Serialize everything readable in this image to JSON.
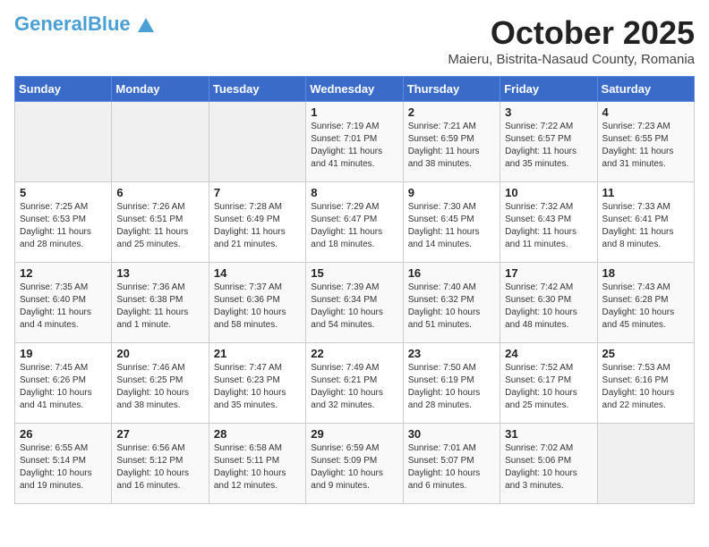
{
  "header": {
    "logo_general": "General",
    "logo_blue": "Blue",
    "title": "October 2025",
    "subtitle": "Maieru, Bistrita-Nasaud County, Romania"
  },
  "weekdays": [
    "Sunday",
    "Monday",
    "Tuesday",
    "Wednesday",
    "Thursday",
    "Friday",
    "Saturday"
  ],
  "weeks": [
    [
      {
        "day": "",
        "empty": true
      },
      {
        "day": "",
        "empty": true
      },
      {
        "day": "",
        "empty": true
      },
      {
        "day": "1",
        "sunrise": "7:19 AM",
        "sunset": "7:01 PM",
        "daylight": "11 hours and 41 minutes."
      },
      {
        "day": "2",
        "sunrise": "7:21 AM",
        "sunset": "6:59 PM",
        "daylight": "11 hours and 38 minutes."
      },
      {
        "day": "3",
        "sunrise": "7:22 AM",
        "sunset": "6:57 PM",
        "daylight": "11 hours and 35 minutes."
      },
      {
        "day": "4",
        "sunrise": "7:23 AM",
        "sunset": "6:55 PM",
        "daylight": "11 hours and 31 minutes."
      }
    ],
    [
      {
        "day": "5",
        "sunrise": "7:25 AM",
        "sunset": "6:53 PM",
        "daylight": "11 hours and 28 minutes."
      },
      {
        "day": "6",
        "sunrise": "7:26 AM",
        "sunset": "6:51 PM",
        "daylight": "11 hours and 25 minutes."
      },
      {
        "day": "7",
        "sunrise": "7:28 AM",
        "sunset": "6:49 PM",
        "daylight": "11 hours and 21 minutes."
      },
      {
        "day": "8",
        "sunrise": "7:29 AM",
        "sunset": "6:47 PM",
        "daylight": "11 hours and 18 minutes."
      },
      {
        "day": "9",
        "sunrise": "7:30 AM",
        "sunset": "6:45 PM",
        "daylight": "11 hours and 14 minutes."
      },
      {
        "day": "10",
        "sunrise": "7:32 AM",
        "sunset": "6:43 PM",
        "daylight": "11 hours and 11 minutes."
      },
      {
        "day": "11",
        "sunrise": "7:33 AM",
        "sunset": "6:41 PM",
        "daylight": "11 hours and 8 minutes."
      }
    ],
    [
      {
        "day": "12",
        "sunrise": "7:35 AM",
        "sunset": "6:40 PM",
        "daylight": "11 hours and 4 minutes."
      },
      {
        "day": "13",
        "sunrise": "7:36 AM",
        "sunset": "6:38 PM",
        "daylight": "11 hours and 1 minute."
      },
      {
        "day": "14",
        "sunrise": "7:37 AM",
        "sunset": "6:36 PM",
        "daylight": "10 hours and 58 minutes."
      },
      {
        "day": "15",
        "sunrise": "7:39 AM",
        "sunset": "6:34 PM",
        "daylight": "10 hours and 54 minutes."
      },
      {
        "day": "16",
        "sunrise": "7:40 AM",
        "sunset": "6:32 PM",
        "daylight": "10 hours and 51 minutes."
      },
      {
        "day": "17",
        "sunrise": "7:42 AM",
        "sunset": "6:30 PM",
        "daylight": "10 hours and 48 minutes."
      },
      {
        "day": "18",
        "sunrise": "7:43 AM",
        "sunset": "6:28 PM",
        "daylight": "10 hours and 45 minutes."
      }
    ],
    [
      {
        "day": "19",
        "sunrise": "7:45 AM",
        "sunset": "6:26 PM",
        "daylight": "10 hours and 41 minutes."
      },
      {
        "day": "20",
        "sunrise": "7:46 AM",
        "sunset": "6:25 PM",
        "daylight": "10 hours and 38 minutes."
      },
      {
        "day": "21",
        "sunrise": "7:47 AM",
        "sunset": "6:23 PM",
        "daylight": "10 hours and 35 minutes."
      },
      {
        "day": "22",
        "sunrise": "7:49 AM",
        "sunset": "6:21 PM",
        "daylight": "10 hours and 32 minutes."
      },
      {
        "day": "23",
        "sunrise": "7:50 AM",
        "sunset": "6:19 PM",
        "daylight": "10 hours and 28 minutes."
      },
      {
        "day": "24",
        "sunrise": "7:52 AM",
        "sunset": "6:17 PM",
        "daylight": "10 hours and 25 minutes."
      },
      {
        "day": "25",
        "sunrise": "7:53 AM",
        "sunset": "6:16 PM",
        "daylight": "10 hours and 22 minutes."
      }
    ],
    [
      {
        "day": "26",
        "sunrise": "6:55 AM",
        "sunset": "5:14 PM",
        "daylight": "10 hours and 19 minutes."
      },
      {
        "day": "27",
        "sunrise": "6:56 AM",
        "sunset": "5:12 PM",
        "daylight": "10 hours and 16 minutes."
      },
      {
        "day": "28",
        "sunrise": "6:58 AM",
        "sunset": "5:11 PM",
        "daylight": "10 hours and 12 minutes."
      },
      {
        "day": "29",
        "sunrise": "6:59 AM",
        "sunset": "5:09 PM",
        "daylight": "10 hours and 9 minutes."
      },
      {
        "day": "30",
        "sunrise": "7:01 AM",
        "sunset": "5:07 PM",
        "daylight": "10 hours and 6 minutes."
      },
      {
        "day": "31",
        "sunrise": "7:02 AM",
        "sunset": "5:06 PM",
        "daylight": "10 hours and 3 minutes."
      },
      {
        "day": "",
        "empty": true
      }
    ]
  ]
}
